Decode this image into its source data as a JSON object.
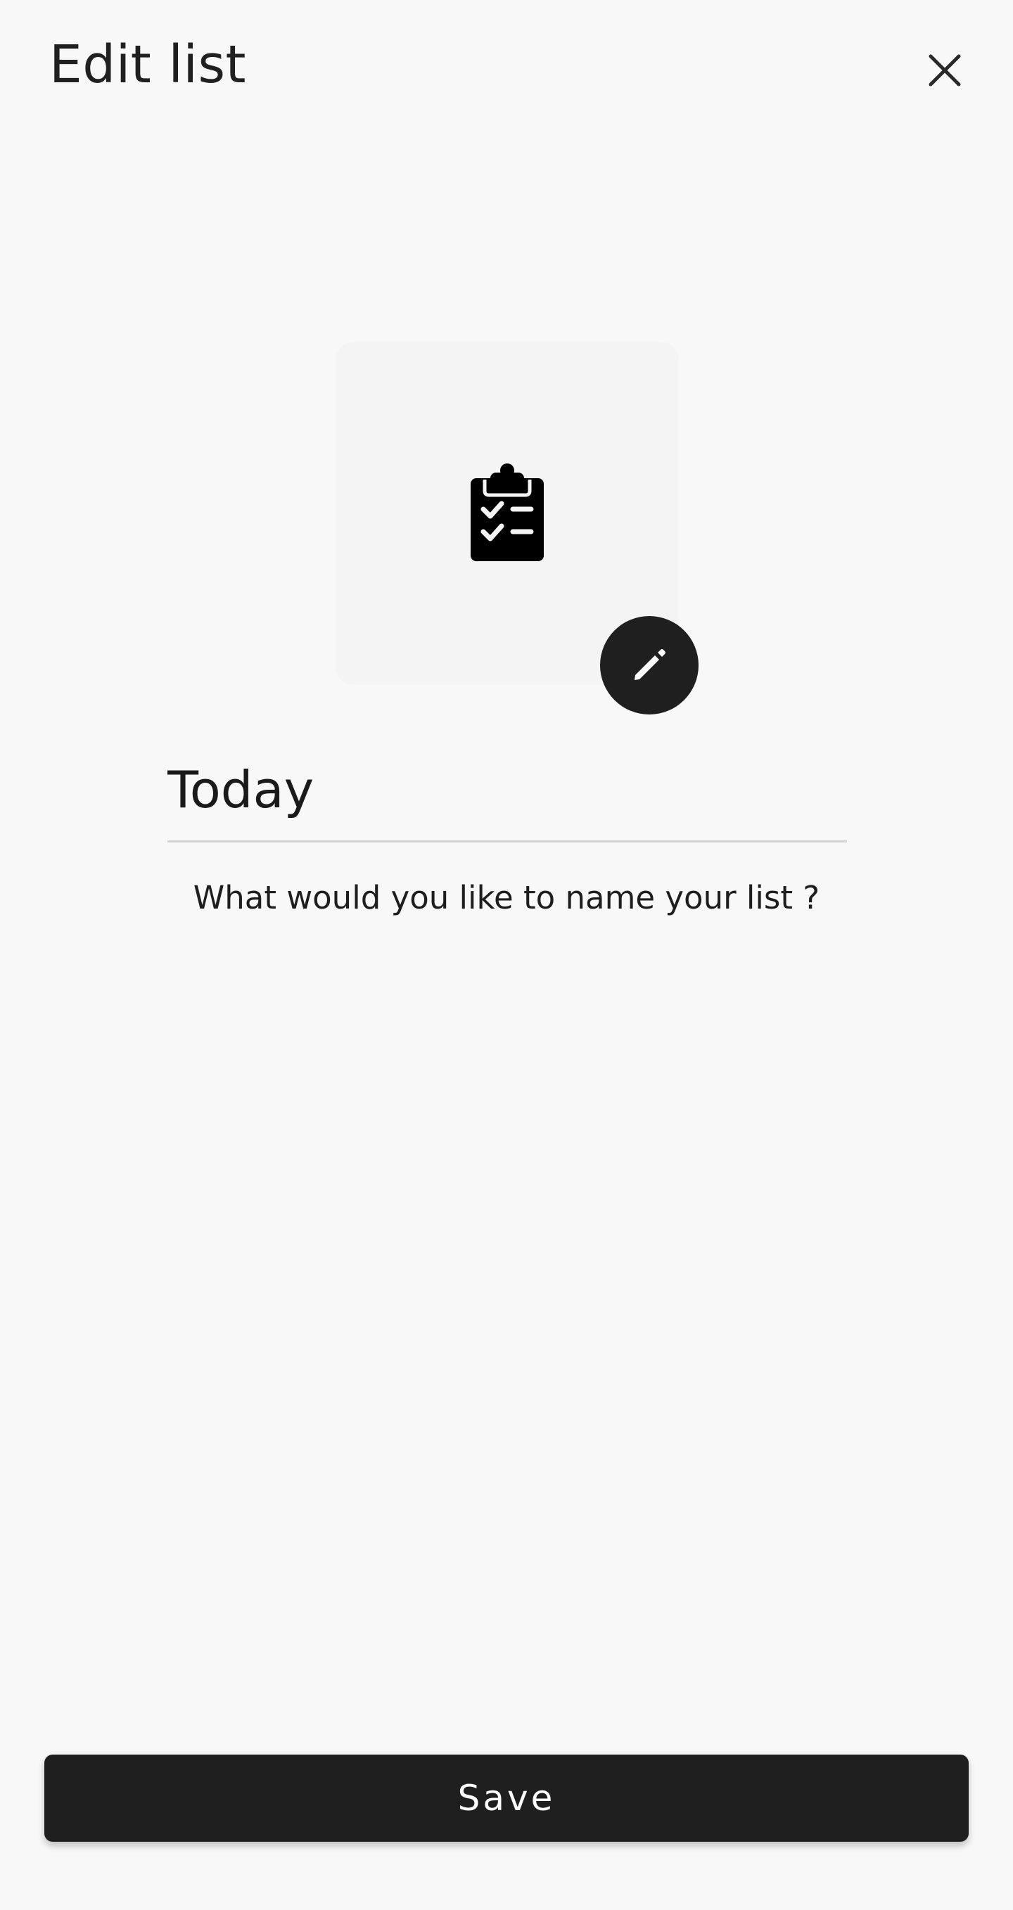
{
  "header": {
    "title": "Edit list",
    "close_icon": "close-icon"
  },
  "list_icon": {
    "icon": "clipboard-check-icon",
    "edit_icon": "pencil-icon"
  },
  "name_field": {
    "value": "Today",
    "helper": "What would you like to name your list ?"
  },
  "footer": {
    "save_label": "Save"
  },
  "colors": {
    "background": "#f8f8f8",
    "card": "#f4f4f4",
    "primary_dark": "#1f1f1f",
    "divider": "#d4d4d4",
    "on_primary": "#ffffff"
  }
}
